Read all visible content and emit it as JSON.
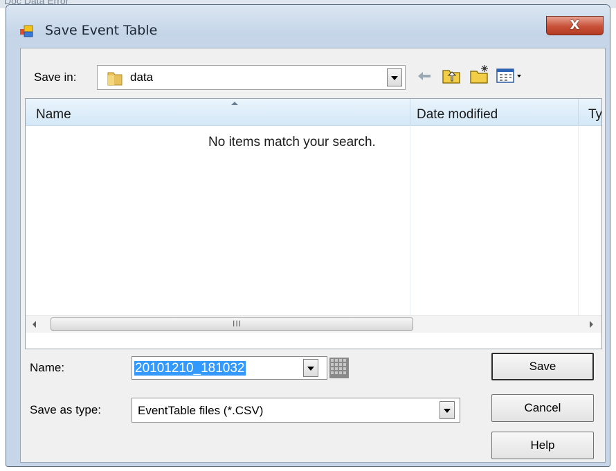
{
  "window": {
    "title": "Save Event Table",
    "close_glyph": "X"
  },
  "background": {
    "text": "Doc  Data  Error"
  },
  "save_in": {
    "label": "Save in:",
    "value": "data"
  },
  "toolbar": {
    "icons": [
      "back-arrow-icon",
      "up-folder-icon",
      "new-folder-icon",
      "view-menu-icon"
    ]
  },
  "file_list": {
    "columns": [
      "Name",
      "Date modified",
      "Ty"
    ],
    "empty_message": "No items match your search.",
    "scroll_grip": "III"
  },
  "name": {
    "label": "Name:",
    "value": "20101210_181032"
  },
  "save_as_type": {
    "label": "Save as type:",
    "value": "EventTable files (*.CSV)"
  },
  "buttons": {
    "save": "Save",
    "cancel": "Cancel",
    "help": "Help"
  },
  "colors": {
    "selection": "#3399ff",
    "close_button": "#c75138",
    "frame": "#c6d6e8"
  }
}
